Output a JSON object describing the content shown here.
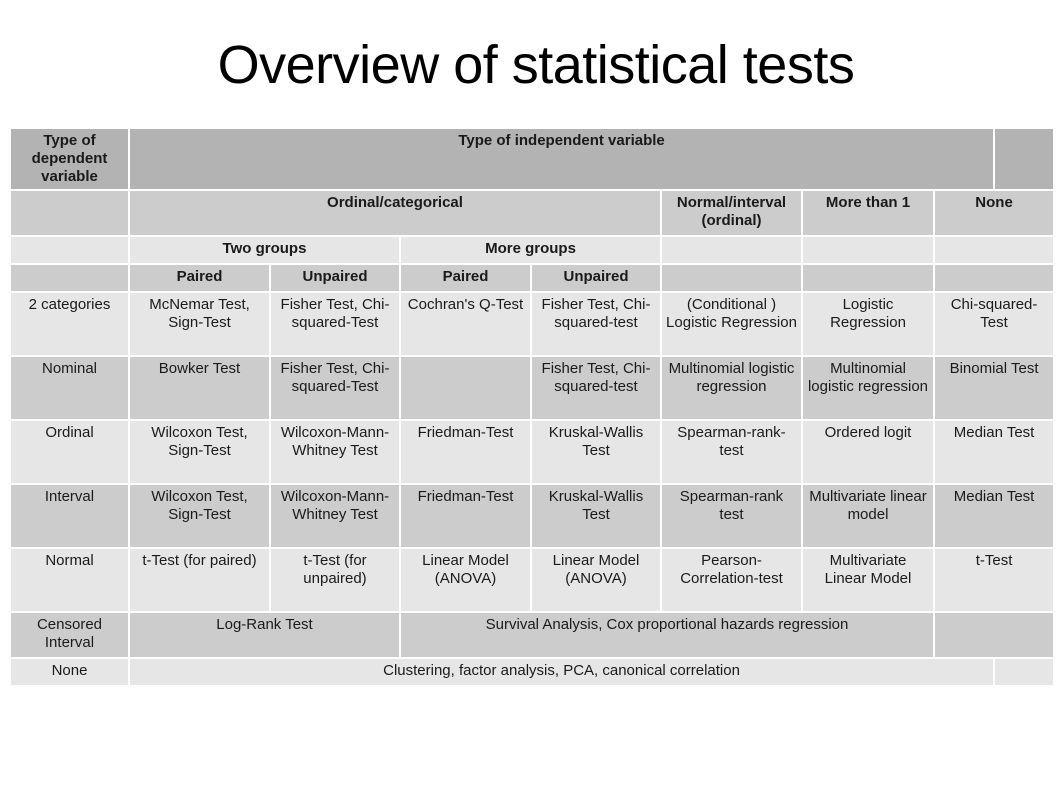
{
  "title": "Overview of statistical tests",
  "header": {
    "dependent_label": "Type of dependent variable",
    "independent_label": "Type of independent variable",
    "ordinal_categorical": "Ordinal/categorical",
    "normal_interval": "Normal/interval (ordinal)",
    "more_than_1": "More than 1",
    "none": "None",
    "two_groups": "Two groups",
    "more_groups": "More groups",
    "paired_1": "Paired",
    "unpaired_1": "Unpaired",
    "paired_2": "Paired",
    "unpaired_2": "Unpaired"
  },
  "rows": [
    {
      "type": "2 categories",
      "cells": [
        "McNemar Test, Sign-Test",
        "Fisher Test, Chi-squared-Test",
        "Cochran's Q-Test",
        "Fisher Test, Chi-squared-test",
        "(Conditional ) Logistic Regression",
        "Logistic Regression",
        "Chi-squared-Test"
      ]
    },
    {
      "type": "Nominal",
      "cells": [
        "Bowker Test",
        "Fisher Test, Chi-squared-Test",
        "",
        "Fisher Test, Chi-squared-test",
        "Multinomial logistic regression",
        "Multinomial logistic regression",
        "Binomial Test"
      ]
    },
    {
      "type": "Ordinal",
      "cells": [
        "Wilcoxon Test, Sign-Test",
        "Wilcoxon-Mann-Whitney Test",
        "Friedman-Test",
        "Kruskal-Wallis Test",
        "Spearman-rank-test",
        "Ordered logit",
        "Median Test"
      ]
    },
    {
      "type": "Interval",
      "cells": [
        "Wilcoxon Test, Sign-Test",
        "Wilcoxon-Mann-Whitney Test",
        "Friedman-Test",
        "Kruskal-Wallis Test",
        "Spearman-rank test",
        "Multivariate linear model",
        "Median Test"
      ]
    },
    {
      "type": "Normal",
      "cells": [
        "t-Test (for paired)",
        "t-Test (for unpaired)",
        "Linear Model (ANOVA)",
        "Linear Model (ANOVA)",
        "Pearson-Correlation-test",
        "Multivariate Linear Model",
        "t-Test"
      ]
    }
  ],
  "censored": {
    "type": "Censored Interval",
    "two_groups": "Log-Rank Test",
    "rest": "Survival Analysis, Cox proportional hazards regression",
    "none": ""
  },
  "none_row": {
    "type": "None",
    "value": "Clustering, factor analysis, PCA, canonical correlation"
  }
}
